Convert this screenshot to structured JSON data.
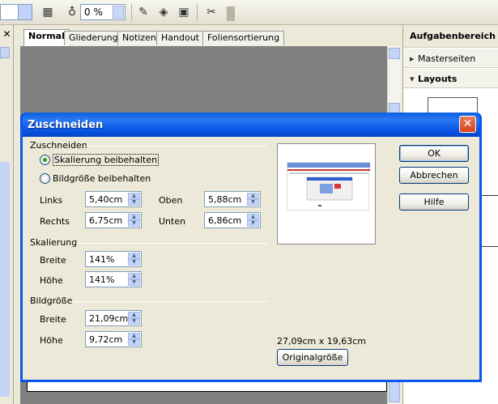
{
  "app": {
    "toolbar": {
      "zoom_value": "0 %",
      "icons": [
        "color-icon",
        "transparency-icon",
        "pen-icon",
        "fill-icon",
        "shadow-icon",
        "crop-icon"
      ]
    },
    "tabs": [
      "Normal",
      "Gliederung",
      "Notizen",
      "Handout",
      "Foliensortierung"
    ],
    "active_tab": "Normal",
    "taskpane": {
      "title": "Aufgabenbereich",
      "sections": [
        "Masterseiten",
        "Layouts"
      ]
    }
  },
  "dialog": {
    "title": "Zuschneiden",
    "crop": {
      "section_label": "Zuschneiden",
      "radio_keep_scale": "Skalierung beibehalten",
      "radio_keep_size": "Bildgröße beibehalten",
      "selected": "Skalierung beibehalten",
      "fields": {
        "left": {
          "label": "Links",
          "value": "5,40cm"
        },
        "right": {
          "label": "Rechts",
          "value": "6,75cm"
        },
        "top": {
          "label": "Oben",
          "value": "5,88cm"
        },
        "bottom": {
          "label": "Unten",
          "value": "6,86cm"
        }
      }
    },
    "scale": {
      "section_label": "Skalierung",
      "width": {
        "label": "Breite",
        "value": "141%"
      },
      "height": {
        "label": "Höhe",
        "value": "141%"
      }
    },
    "image_size": {
      "section_label": "Bildgröße",
      "width": {
        "label": "Breite",
        "value": "21,09cm"
      },
      "height": {
        "label": "Höhe",
        "value": "9,72cm"
      }
    },
    "original_dimensions": "27,09cm x 19,63cm",
    "buttons": {
      "ok": "OK",
      "cancel": "Abbrechen",
      "help": "Hilfe",
      "original_size": "Originalgröße"
    }
  }
}
